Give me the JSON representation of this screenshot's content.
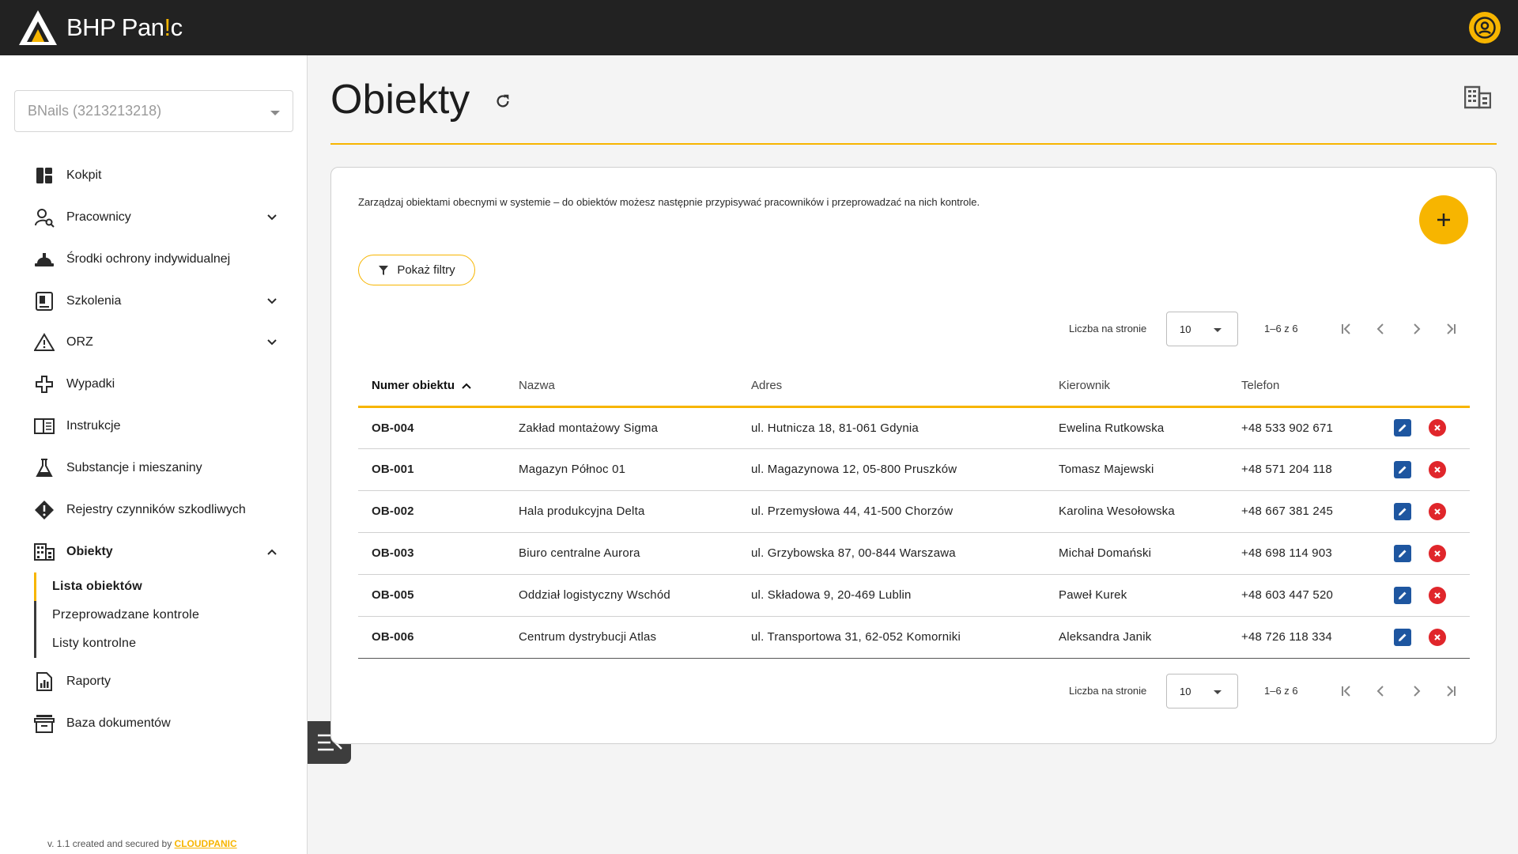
{
  "app": {
    "brand_prefix": "BHP Pan",
    "brand_accent": "!",
    "brand_suffix": "c",
    "accent_color": "#f7b500"
  },
  "sidebar": {
    "company": "BNails (3213213218)",
    "items": [
      {
        "label": "Kokpit",
        "icon": "dashboard-icon"
      },
      {
        "label": "Pracownicy",
        "icon": "person-search-icon",
        "expandable": true
      },
      {
        "label": "Środki ochrony indywidualnej",
        "icon": "helmet-icon"
      },
      {
        "label": "Szkolenia",
        "icon": "training-icon",
        "expandable": true
      },
      {
        "label": "ORZ",
        "icon": "risk-warning-icon",
        "expandable": true
      },
      {
        "label": "Wypadki",
        "icon": "medical-icon"
      },
      {
        "label": "Instrukcje",
        "icon": "instructions-icon"
      },
      {
        "label": "Substancje i mieszaniny",
        "icon": "flask-icon"
      },
      {
        "label": "Rejestry czynników szkodliwych",
        "icon": "hazard-icon"
      },
      {
        "label": "Obiekty",
        "icon": "building-icon",
        "expanded": true
      },
      {
        "label": "Raporty",
        "icon": "report-icon"
      },
      {
        "label": "Baza dokumentów",
        "icon": "archive-icon"
      }
    ],
    "subitems": [
      {
        "label": "Lista obiektów",
        "selected": true
      },
      {
        "label": "Przeprowadzane kontrole"
      },
      {
        "label": "Listy kontrolne"
      }
    ],
    "version_text": "v. 1.1 created and secured by ",
    "version_brand": "CLOUDPANIC"
  },
  "main": {
    "title": "Obiekty",
    "description": "Zarządzaj obiektami obecnymi w systemie – do obiektów możesz następnie przypisywać pracowników i przeprowadzać na nich kontrole.",
    "filter_label": "Pokaż filtry",
    "pager": {
      "per_page_label": "Liczba na stronie",
      "per_page_value": "10",
      "range": "1–6 z 6"
    },
    "table": {
      "columns": [
        "Numer obiektu",
        "Nazwa",
        "Adres",
        "Kierownik",
        "Telefon"
      ],
      "rows": [
        {
          "num": "OB-004",
          "name": "Zakład montażowy Sigma",
          "address": "ul. Hutnicza 18, 81-061 Gdynia",
          "manager": "Ewelina Rutkowska",
          "phone": "+48 533 902 671"
        },
        {
          "num": "OB-001",
          "name": "Magazyn Północ 01",
          "address": "ul. Magazynowa 12, 05-800 Pruszków",
          "manager": "Tomasz Majewski",
          "phone": "+48 571 204 118"
        },
        {
          "num": "OB-002",
          "name": "Hala produkcyjna Delta",
          "address": "ul. Przemysłowa 44, 41-500 Chorzów",
          "manager": "Karolina Wesołowska",
          "phone": "+48 667 381 245"
        },
        {
          "num": "OB-003",
          "name": "Biuro centralne Aurora",
          "address": "ul. Grzybowska 87, 00-844 Warszawa",
          "manager": "Michał Domański",
          "phone": "+48 698 114 903"
        },
        {
          "num": "OB-005",
          "name": "Oddział logistyczny Wschód",
          "address": "ul. Składowa 9, 20-469 Lublin",
          "manager": "Paweł Kurek",
          "phone": "+48 603 447 520"
        },
        {
          "num": "OB-006",
          "name": "Centrum dystrybucji Atlas",
          "address": "ul. Transportowa 31, 62-052 Komorniki",
          "manager": "Aleksandra Janik",
          "phone": "+48 726 118 334"
        }
      ]
    }
  }
}
